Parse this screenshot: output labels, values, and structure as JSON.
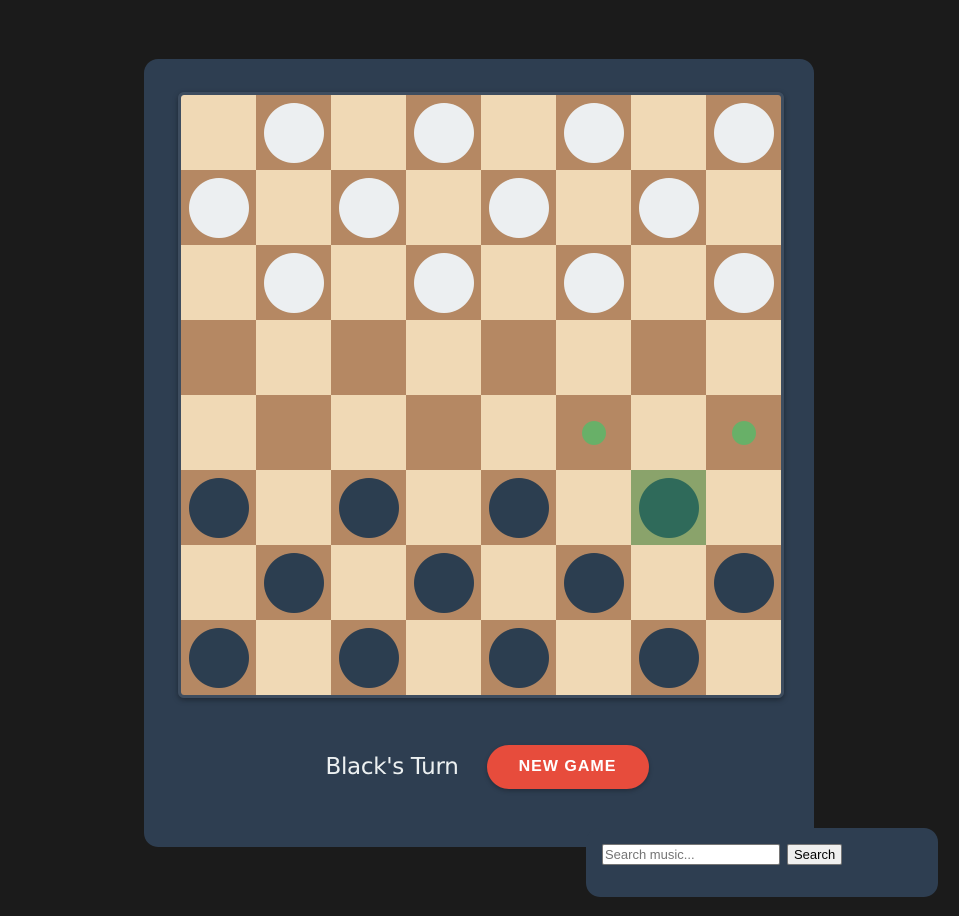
{
  "game": {
    "status_text": "Black's Turn",
    "new_game_label": "NEW GAME"
  },
  "board": {
    "size": 8,
    "rows": [
      [
        "",
        "w",
        "",
        "w",
        "",
        "w",
        "",
        "w"
      ],
      [
        "w",
        "",
        "w",
        "",
        "w",
        "",
        "w",
        ""
      ],
      [
        "",
        "w",
        "",
        "w",
        "",
        "w",
        "",
        "w"
      ],
      [
        "",
        "",
        "",
        "",
        "",
        "",
        "",
        ""
      ],
      [
        "",
        "",
        "",
        "",
        "",
        "",
        "",
        ""
      ],
      [
        "b",
        "",
        "b",
        "",
        "b",
        "",
        "b",
        ""
      ],
      [
        "",
        "b",
        "",
        "b",
        "",
        "b",
        "",
        "b"
      ],
      [
        "b",
        "",
        "b",
        "",
        "b",
        "",
        "b",
        ""
      ]
    ],
    "selected": {
      "row": 5,
      "col": 6
    },
    "valid_moves": [
      {
        "row": 4,
        "col": 5
      },
      {
        "row": 4,
        "col": 7
      }
    ],
    "colors": {
      "light_square": "#f0d9b5",
      "dark_square": "#b58863",
      "selected_square": "#8aa36b",
      "white_piece": "#eceff1",
      "black_piece": "#2c3e50",
      "selected_piece": "#2f6a5a",
      "move_hint": "#68b068"
    }
  },
  "music": {
    "search_placeholder": "Search music...",
    "search_value": "",
    "search_button_label": "Search"
  }
}
